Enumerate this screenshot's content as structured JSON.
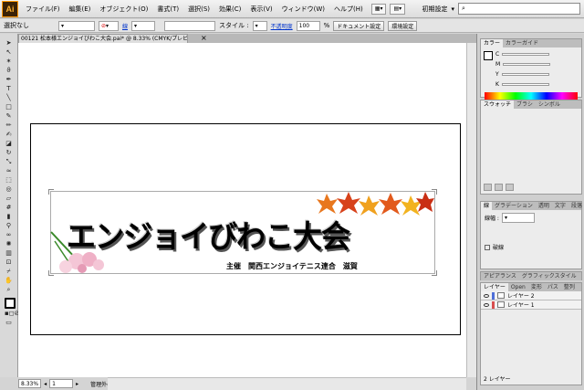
{
  "app": {
    "logo": "Ai"
  },
  "menu": {
    "items": [
      "ファイル(F)",
      "編集(E)",
      "オブジェクト(O)",
      "書式(T)",
      "選択(S)",
      "効果(C)",
      "表示(V)",
      "ウィンドウ(W)",
      "ヘルプ(H)"
    ],
    "workspace": "初期設定",
    "search_placeholder": ""
  },
  "control_bar": {
    "selection": "選択なし",
    "stroke_label": "線",
    "style_label": "スタイル :",
    "opacity_label": "不透明度",
    "opacity_value": "100",
    "opacity_unit": "%",
    "doc_setup": "ドキュメント設定",
    "env_setup": "環境設定"
  },
  "document": {
    "tab_title": "00121 松本様エンジョイびわこ大会.pai* @ 8.33% (CMYK/プレビュー)",
    "close": "×"
  },
  "artwork": {
    "title": "エンジョイびわこ大会",
    "subtitle": "主催　関西エンジョイテニス連合　滋賀"
  },
  "status": {
    "zoom": "8.33%",
    "page": "1",
    "info": "管理外のファイル"
  },
  "panels": {
    "color_tabs": [
      "カラー",
      "カラーガイド"
    ],
    "color_channels": [
      "C",
      "M",
      "Y",
      "K"
    ],
    "swatch_tabs": [
      "スウォッチ",
      "ブラシ",
      "シンボル"
    ],
    "stroke_tabs": [
      "線",
      "グラデーション",
      "透明",
      "文字",
      "段落"
    ],
    "stroke_weight_label": "線幅 :",
    "dash_label": "破線",
    "appearance_tabs": [
      "アピアランス",
      "グラフィックスタイル"
    ],
    "layer_tabs": [
      "レイヤー",
      "Open",
      "変形",
      "パス",
      "整列"
    ],
    "layers": [
      {
        "name": "レイヤー 2",
        "color": "#4f6fd8"
      },
      {
        "name": "レイヤー 1",
        "color": "#d84f4f"
      }
    ],
    "layer_count": "2 レイヤー"
  }
}
